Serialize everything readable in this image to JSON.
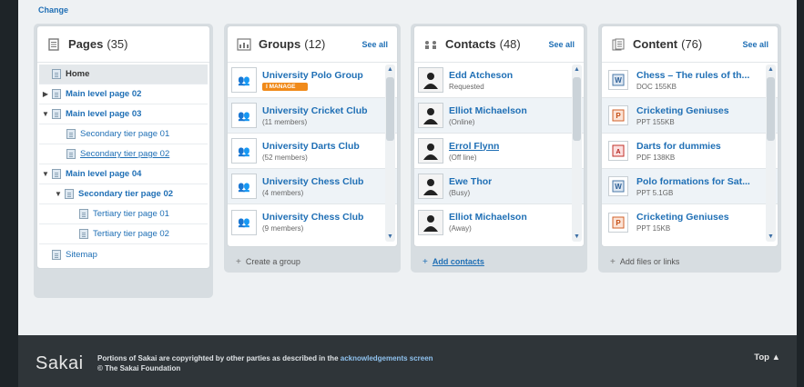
{
  "top": {
    "change_label": "Change"
  },
  "pages": {
    "title": "Pages",
    "count": "(35)",
    "icon": "pages-icon",
    "items": [
      {
        "label": "Home"
      },
      {
        "label": "Main level page 02"
      },
      {
        "label": "Main level page 03"
      },
      {
        "label": "Secondary tier page 01"
      },
      {
        "label": "Secondary tier page 02"
      },
      {
        "label": "Main level page 04"
      },
      {
        "label": "Secondary tier page 02"
      },
      {
        "label": "Tertiary tier page 01"
      },
      {
        "label": "Tertiary tier page 02"
      },
      {
        "label": "Sitemap"
      }
    ]
  },
  "groups": {
    "title": "Groups",
    "count": "(12)",
    "see_all": "See all",
    "icon": "groups-icon",
    "items": [
      {
        "title": "University Polo Group",
        "badge": "I MANAGE"
      },
      {
        "title": "University Cricket Club",
        "sub": "(11 members)"
      },
      {
        "title": "University Darts Club",
        "sub": "(52 members)"
      },
      {
        "title": "University Chess Club",
        "sub": "(4 members)"
      },
      {
        "title": "University Chess Club",
        "sub": "(9 members)"
      }
    ],
    "footer": "Create a group"
  },
  "contacts": {
    "title": "Contacts",
    "count": "(48)",
    "see_all": "See all",
    "icon": "contacts-icon",
    "items": [
      {
        "title": "Edd Atcheson",
        "sub": "Requested"
      },
      {
        "title": "Elliot Michaelson",
        "sub": "(Online)"
      },
      {
        "title": "Errol Flynn",
        "sub": "(Off line)"
      },
      {
        "title": "Ewe Thor",
        "sub": "(Busy)"
      },
      {
        "title": "Elliot Michaelson",
        "sub": "(Away)"
      }
    ],
    "footer": "Add contacts"
  },
  "content": {
    "title": "Content",
    "count": "(76)",
    "see_all": "See all",
    "icon": "content-icon",
    "items": [
      {
        "title": "Chess – The rules of th...",
        "sub": "DOC 155KB"
      },
      {
        "title": "Cricketing Geniuses",
        "sub": "PPT 155KB"
      },
      {
        "title": "Darts for dummies",
        "sub": "PDF 138KB"
      },
      {
        "title": "Polo formations for Sat...",
        "sub": "PPT 5.1GB"
      },
      {
        "title": "Cricketing Geniuses",
        "sub": "PPT 15KB"
      }
    ],
    "footer": "Add files or links"
  },
  "footer": {
    "logo": "Sakai",
    "line1_prefix": "Portions of Sakai are copyrighted by other parties as described in the",
    "line1_link": "acknowledgements screen",
    "line2": "© The Sakai Foundation",
    "top_label": "Top ▲"
  },
  "colors": {
    "link": "#1f6fb5",
    "badge": "#f08a1a",
    "footer_bg": "#2f3539",
    "page_bg": "#eef1f3"
  }
}
